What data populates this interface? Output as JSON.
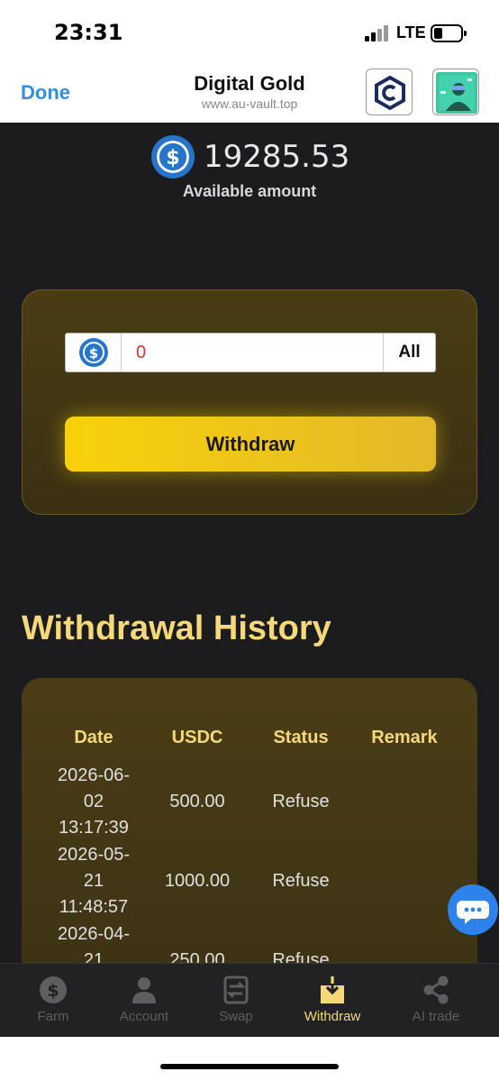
{
  "status_bar": {
    "time": "23:31",
    "network": "LTE"
  },
  "header": {
    "done_label": "Done",
    "title": "Digital Gold",
    "url": "www.au-vault.top"
  },
  "balance": {
    "amount": "19285.53",
    "label": "Available amount"
  },
  "withdraw_form": {
    "amount_value": "0",
    "all_label": "All",
    "submit_label": "Withdraw"
  },
  "history": {
    "title": "Withdrawal History",
    "columns": [
      "Date",
      "USDC",
      "Status",
      "Remark"
    ],
    "rows": [
      {
        "date_l1": "2026-06-",
        "date_l2": "02",
        "date_l3": "13:17:39",
        "usdc": "500.00",
        "status": "Refuse",
        "remark": ""
      },
      {
        "date_l1": "2026-05-",
        "date_l2": "21",
        "date_l3": "11:48:57",
        "usdc": "1000.00",
        "status": "Refuse",
        "remark": ""
      },
      {
        "date_l1": "2026-04-",
        "date_l2": "21",
        "date_l3": "",
        "usdc": "250.00",
        "status": "Refuse",
        "remark": ""
      }
    ]
  },
  "tabs": [
    {
      "label": "Farm",
      "icon": "dollar-coin-icon",
      "active": false
    },
    {
      "label": "Account",
      "icon": "person-icon",
      "active": false
    },
    {
      "label": "Swap",
      "icon": "swap-icon",
      "active": false
    },
    {
      "label": "Withdraw",
      "icon": "download-icon",
      "active": true
    },
    {
      "label": "AI trade",
      "icon": "share-icon",
      "active": false
    }
  ],
  "colors": {
    "accent_gold": "#f4d87a",
    "button_gold": "#f8d10a",
    "link_blue": "#2f8fe0",
    "usdc_blue": "#2775ca",
    "background": "#1c1c1e"
  }
}
